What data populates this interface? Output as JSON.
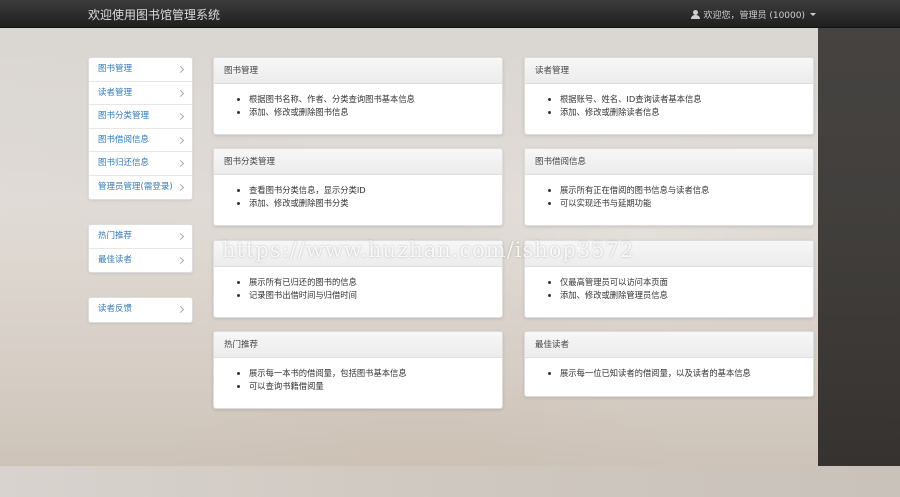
{
  "navbar": {
    "brand": "欢迎使用图书馆管理系统",
    "user_label": "欢迎您，管理员 (10000)"
  },
  "sidebar": {
    "group1": [
      {
        "label": "图书管理"
      },
      {
        "label": "读者管理"
      },
      {
        "label": "图书分类管理"
      },
      {
        "label": "图书借阅信息"
      },
      {
        "label": "图书归还信息"
      },
      {
        "label": "管理员管理(需登录)"
      }
    ],
    "group2": [
      {
        "label": "热门推荐"
      },
      {
        "label": "最佳读者"
      }
    ],
    "group3": [
      {
        "label": "读者反馈"
      }
    ]
  },
  "panels": [
    {
      "title": "图书管理",
      "items": [
        "根据图书名称、作者、分类查询图书基本信息",
        "添加、修改或删除图书信息"
      ]
    },
    {
      "title": "读者管理",
      "items": [
        "根据账号、姓名、ID查询读者基本信息",
        "添加、修改或删除读者信息"
      ]
    },
    {
      "title": "图书分类管理",
      "items": [
        "查看图书分类信息，显示分类ID",
        "添加、修改或删除图书分类"
      ]
    },
    {
      "title": "图书借阅信息",
      "items": [
        "展示所有正在借阅的图书信息与读者信息",
        "可以实现还书与延期功能"
      ]
    },
    {
      "title": "",
      "items": [
        "展示所有已归还的图书的信息",
        "记录图书出借时间与归借时间"
      ]
    },
    {
      "title": "",
      "items": [
        "仅最高管理员可以访问本页面",
        "添加、修改或删除管理员信息"
      ]
    },
    {
      "title": "热门推荐",
      "items": [
        "展示每一本书的借阅量，包括图书基本信息",
        "可以查询书籍借阅量"
      ]
    },
    {
      "title": "最佳读者",
      "items": [
        "展示每一位已知读者的借阅量，以及读者的基本信息"
      ]
    }
  ],
  "watermark": "https://www.huzhan.com/ishop3572"
}
